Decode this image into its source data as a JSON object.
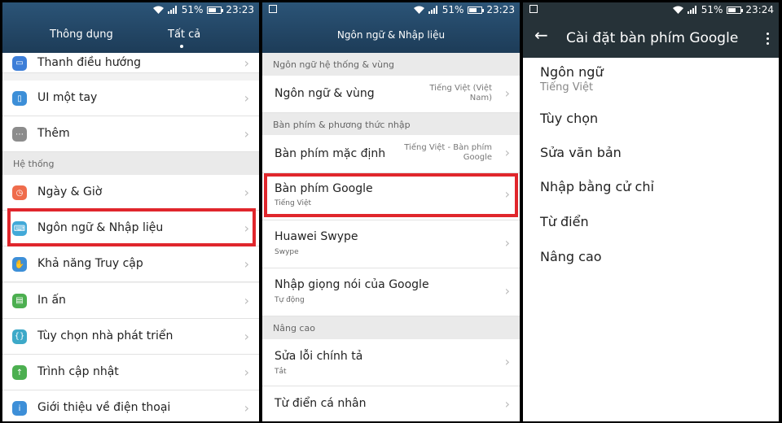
{
  "status": {
    "battery_percent": "51%",
    "battery_level": 0.51,
    "time_1": "23:23",
    "time_2": "23:23",
    "time_3": "23:24"
  },
  "panel1": {
    "tab_left": "Thông dụng",
    "tab_right": "Tất cả",
    "items_top": [
      {
        "label": "Thanh điều hướng",
        "icon": "navigation-icon",
        "color": "#3d7ed8"
      },
      {
        "label": "UI một tay",
        "icon": "one-hand-icon",
        "color": "#3d8fd8"
      },
      {
        "label": "Thêm",
        "icon": "more-icon",
        "color": "#8c8c8c"
      }
    ],
    "section": "Hệ thống",
    "items": [
      {
        "label": "Ngày & Giờ",
        "icon": "clock-icon",
        "color": "#ef6c4c"
      },
      {
        "label": "Ngôn ngữ & Nhập liệu",
        "icon": "keyboard-icon",
        "color": "#42a9d8"
      },
      {
        "label": "Khả năng Truy cập",
        "icon": "hand-icon",
        "color": "#3d8fd8"
      },
      {
        "label": "In ấn",
        "icon": "printer-icon",
        "color": "#4caf50"
      },
      {
        "label": "Tùy chọn nhà phát triển",
        "icon": "developer-icon",
        "color": "#3da9c8"
      },
      {
        "label": "Trình cập nhật",
        "icon": "update-icon",
        "color": "#4caf50"
      },
      {
        "label": "Giới thiệu về điện thoại",
        "icon": "info-icon",
        "color": "#3d8fd8"
      }
    ]
  },
  "panel2": {
    "title": "Ngôn ngữ & Nhập liệu",
    "section_1": "Ngôn ngữ hệ thống & vùng",
    "language_region": {
      "label": "Ngôn ngữ & vùng",
      "value_1": "Tiếng Việt (Việt",
      "value_2": "Nam)"
    },
    "section_2": "Bàn phím & phương thức nhập",
    "default_keyboard": {
      "label": "Bàn phím mặc định",
      "value_1": "Tiếng Việt - Bàn phím",
      "value_2": "Google"
    },
    "google_keyboard": {
      "label": "Bàn phím Google",
      "sub": "Tiếng Việt"
    },
    "huawei_swype": {
      "label": "Huawei Swype",
      "sub": "Swype"
    },
    "google_voice": {
      "label": "Nhập giọng nói của Google",
      "sub": "Tự động"
    },
    "section_3": "Nâng cao",
    "spell_check": {
      "label": "Sửa lỗi chính tả",
      "sub": "Tắt"
    },
    "personal_dictionary": {
      "label": "Từ điển cá nhân"
    }
  },
  "panel3": {
    "title": "Cài đặt bàn phím Google",
    "language_label": "Ngôn ngữ",
    "language_value": "Tiếng Việt",
    "options": "Tùy chọn",
    "text_correction": "Sửa văn bản",
    "gesture_typing": "Nhập bằng cử chỉ",
    "dictionary": "Từ điển",
    "advanced": "Nâng cao"
  },
  "colors": {
    "highlight": "#e0262c",
    "header_blue": "#2b5477",
    "header_dark": "#263238"
  }
}
